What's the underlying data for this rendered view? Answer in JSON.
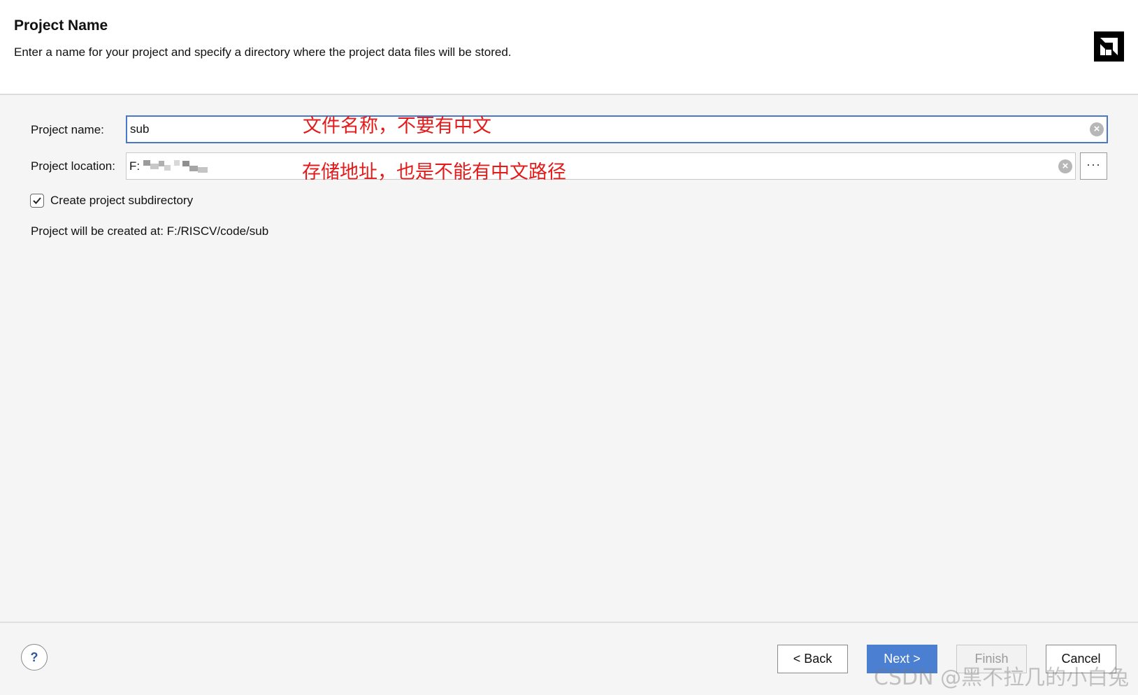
{
  "header": {
    "title": "Project Name",
    "description": "Enter a name for your project and specify a directory where the project data files will be stored."
  },
  "form": {
    "project_name_label": "Project name:",
    "project_name_value": "sub",
    "project_location_label": "Project location:",
    "project_location_value": "F:",
    "browse_label": "···",
    "create_subdirectory_label": "Create project subdirectory",
    "create_subdirectory_checked": true,
    "project_path_text": "Project will be created at: F:/RISCV/code/sub"
  },
  "annotations": {
    "name_note": "文件名称，不要有中文",
    "location_note": "存储地址，也是不能有中文路径"
  },
  "footer": {
    "help_label": "?",
    "back_label": "< Back",
    "next_label": "Next >",
    "finish_label": "Finish",
    "cancel_label": "Cancel"
  },
  "watermark": "CSDN @黑不拉几的小白兔",
  "colors": {
    "accent": "#4a7fd1",
    "focus_border": "#4a78c9",
    "annotation": "#e21b1b"
  }
}
